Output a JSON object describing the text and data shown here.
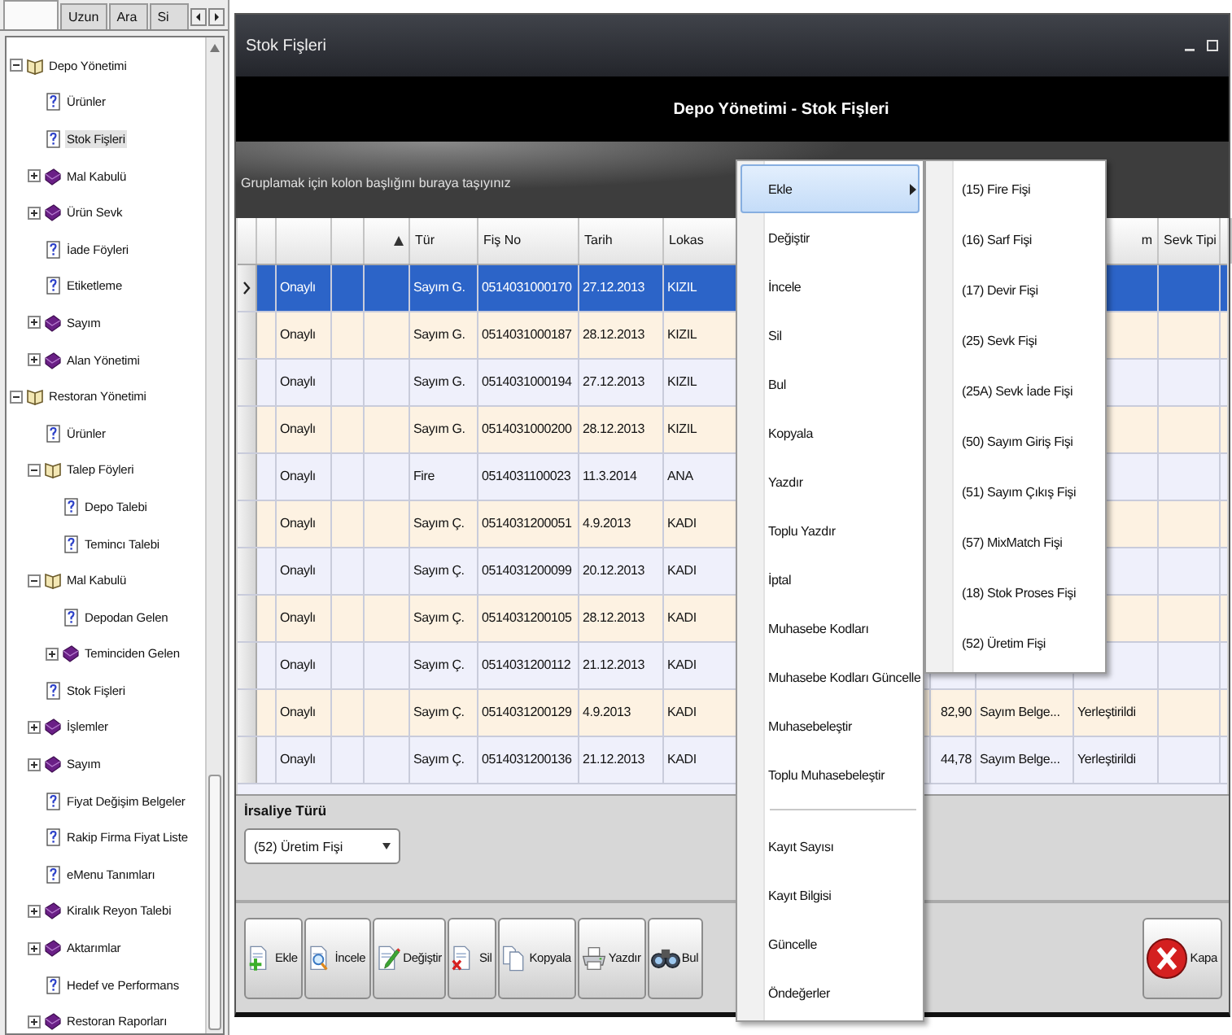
{
  "navigator": {
    "tabs": [
      {
        "selected": true
      },
      {
        "label": "Uzun",
        "selected": false
      },
      {
        "label": "Ara",
        "selected": false
      },
      {
        "label": "Si",
        "selected": false
      }
    ],
    "tree": [
      {
        "label": "Depo Yönetimi",
        "kind": "module",
        "expanded": true,
        "selected": false,
        "children": [
          {
            "label": "Ürünler",
            "kind": "page",
            "selected": false
          },
          {
            "label": "Stok Fişleri",
            "kind": "page",
            "selected": true
          },
          {
            "label": "Mal Kabulü",
            "kind": "folder",
            "expanded": false,
            "selected": false
          },
          {
            "label": "Ürün Sevk",
            "kind": "folder",
            "expanded": false,
            "selected": false
          },
          {
            "label": "İade Föyleri",
            "kind": "page",
            "selected": false
          },
          {
            "label": "Etiketleme",
            "kind": "page",
            "selected": false
          },
          {
            "label": "Sayım",
            "kind": "folder",
            "expanded": false,
            "selected": false
          },
          {
            "label": "Alan Yönetimi",
            "kind": "folder",
            "expanded": false,
            "selected": false
          }
        ]
      },
      {
        "label": "Restoran Yönetimi",
        "kind": "module",
        "expanded": true,
        "selected": false,
        "children": [
          {
            "label": "Ürünler",
            "kind": "page",
            "selected": false
          },
          {
            "label": "Talep Föyleri",
            "kind": "module",
            "expanded": true,
            "selected": false,
            "children": [
              {
                "label": "Depo Talebi",
                "kind": "page",
                "selected": false
              },
              {
                "label": "Temincı Talebi",
                "kind": "page",
                "selected": false
              }
            ]
          },
          {
            "label": "Mal Kabulü",
            "kind": "module",
            "expanded": true,
            "selected": false,
            "children": [
              {
                "label": "Depodan Gelen",
                "kind": "page",
                "selected": false
              },
              {
                "label": "Teminciden Gelen",
                "kind": "folder",
                "expanded": false,
                "selected": false
              }
            ]
          },
          {
            "label": "Stok Fişleri",
            "kind": "page",
            "selected": false
          },
          {
            "label": "İşlemler",
            "kind": "folder",
            "expanded": false,
            "selected": false
          },
          {
            "label": "Sayım",
            "kind": "folder",
            "expanded": false,
            "selected": false
          },
          {
            "label": "Fiyat Değişim Belgeler",
            "kind": "page",
            "selected": false
          },
          {
            "label": "Rakip Firma Fiyat Liste",
            "kind": "page",
            "selected": false
          },
          {
            "label": "eMenu Tanımları",
            "kind": "page",
            "selected": false
          },
          {
            "label": "Kiralık Reyon Talebi",
            "kind": "folder",
            "expanded": false,
            "selected": false
          },
          {
            "label": "Aktarımlar",
            "kind": "folder",
            "expanded": false,
            "selected": false
          },
          {
            "label": "Hedef ve Performans",
            "kind": "page",
            "selected": false
          },
          {
            "label": "Restoran Raporları",
            "kind": "folder",
            "expanded": false,
            "selected": false
          }
        ]
      }
    ]
  },
  "window": {
    "title": "Stok Fişleri",
    "header": "Depo Yönetimi - Stok Fişleri",
    "group_hint": "Gruplamak için kolon başlığını buraya taşıyınız",
    "table": {
      "header": {
        "tur": "Tür",
        "fis_no": "Fiş No",
        "tarih": "Tarih",
        "lokas": "Lokas",
        "column_11": "m",
        "sevk_tipi": "Sevk Tipi"
      },
      "sort_ascending": true,
      "rows": [
        {
          "selected": true,
          "column_2": "Onaylı",
          "tur": "Sayım G.",
          "fis_no": "0514031000170",
          "tarih": "27.12.2013",
          "lokas": "KIZIL"
        },
        {
          "selected": false,
          "column_2": "Onaylı",
          "tur": "Sayım G.",
          "fis_no": "0514031000187",
          "tarih": "28.12.2013",
          "lokas": "KIZIL"
        },
        {
          "selected": false,
          "column_2": "Onaylı",
          "tur": "Sayım G.",
          "fis_no": "0514031000194",
          "tarih": "27.12.2013",
          "lokas": "KIZIL"
        },
        {
          "selected": false,
          "column_2": "Onaylı",
          "tur": "Sayım G.",
          "fis_no": "0514031000200",
          "tarih": "28.12.2013",
          "lokas": "KIZIL"
        },
        {
          "selected": false,
          "column_2": "Onaylı",
          "tur": "Fire",
          "fis_no": "0514031100023",
          "tarih": "11.3.2014",
          "lokas": "ANA"
        },
        {
          "selected": false,
          "column_2": "Onaylı",
          "tur": "Sayım Ç.",
          "fis_no": "0514031200051",
          "tarih": "4.9.2013",
          "lokas": "KADI"
        },
        {
          "selected": false,
          "column_2": "Onaylı",
          "tur": "Sayım Ç.",
          "fis_no": "0514031200099",
          "tarih": "20.12.2013",
          "lokas": "KADI"
        },
        {
          "selected": false,
          "column_2": "Onaylı",
          "tur": "Sayım Ç.",
          "fis_no": "0514031200105",
          "tarih": "28.12.2013",
          "lokas": "KADI"
        },
        {
          "selected": false,
          "column_2": "Onaylı",
          "tur": "Sayım Ç.",
          "fis_no": "0514031200112",
          "tarih": "21.12.2013",
          "lokas": "KADI"
        },
        {
          "selected": false,
          "column_2": "Onaylı",
          "tur": "Sayım Ç.",
          "fis_no": "0514031200129",
          "tarih": "4.9.2013",
          "lokas": "KADI",
          "column_9": "82,90",
          "column_10": "Sayım Belge...",
          "column_11": "Yerleştirildi"
        },
        {
          "selected": false,
          "column_2": "Onaylı",
          "tur": "Sayım Ç.",
          "fis_no": "0514031200136",
          "tarih": "21.12.2013",
          "lokas": "KADI",
          "column_9": "44,78",
          "column_10": "Sayım Belge...",
          "column_11": "Yerleştirildi"
        }
      ]
    },
    "irsaliye": {
      "legend": "İrsaliye Türü",
      "value": "(52) Üretim Fişi"
    },
    "buttons": [
      {
        "label": "Ekle",
        "kind": "add"
      },
      {
        "label": "İncele",
        "kind": "inspect"
      },
      {
        "label": "Değiştir",
        "kind": "edit"
      },
      {
        "label": "Sil",
        "kind": "delete"
      },
      {
        "label": "Kopyala",
        "kind": "copy"
      },
      {
        "label": "Yazdır",
        "kind": "print"
      },
      {
        "label": "Bul",
        "kind": "find"
      }
    ],
    "close_button": {
      "label": "Kapa"
    }
  },
  "context_menu": {
    "items": [
      {
        "kind": "item",
        "label": "Ekle",
        "selected": true,
        "submenu": true
      },
      {
        "kind": "item",
        "label": "Değiştir",
        "selected": false
      },
      {
        "kind": "item",
        "label": "İncele",
        "selected": false
      },
      {
        "kind": "item",
        "label": "Sil",
        "selected": false
      },
      {
        "kind": "item",
        "label": "Bul",
        "selected": false
      },
      {
        "kind": "item",
        "label": "Kopyala",
        "selected": false
      },
      {
        "kind": "item",
        "label": "Yazdır",
        "selected": false
      },
      {
        "kind": "item",
        "label": "Toplu Yazdır",
        "selected": false
      },
      {
        "kind": "item",
        "label": "İptal",
        "selected": false
      },
      {
        "kind": "item",
        "label": "Muhasebe Kodları",
        "selected": false
      },
      {
        "kind": "item",
        "label": "Muhasebe Kodları Güncelle",
        "selected": false
      },
      {
        "kind": "item",
        "label": "Muhasebeleştir",
        "selected": false
      },
      {
        "kind": "item",
        "label": "Toplu Muhasebeleştir",
        "selected": false
      },
      {
        "kind": "separator"
      },
      {
        "kind": "item",
        "label": "Kayıt Sayısı",
        "selected": false
      },
      {
        "kind": "item",
        "label": "Kayıt Bilgisi",
        "selected": false
      },
      {
        "kind": "item",
        "label": "Güncelle",
        "selected": false
      },
      {
        "kind": "item",
        "label": "Öndeğerler",
        "selected": false
      }
    ],
    "submenu": [
      "(15) Fire Fişi",
      "(16) Sarf Fişi",
      "(17) Devir Fişi",
      "(25) Sevk Fişi",
      "(25A) Sevk İade Fişi",
      "(50) Sayım Giriş Fişi",
      "(51) Sayım Çıkış Fişi",
      "(57) MixMatch Fişi",
      "(18) Stok Proses Fişi",
      "(52) Üretim Fişi"
    ]
  }
}
